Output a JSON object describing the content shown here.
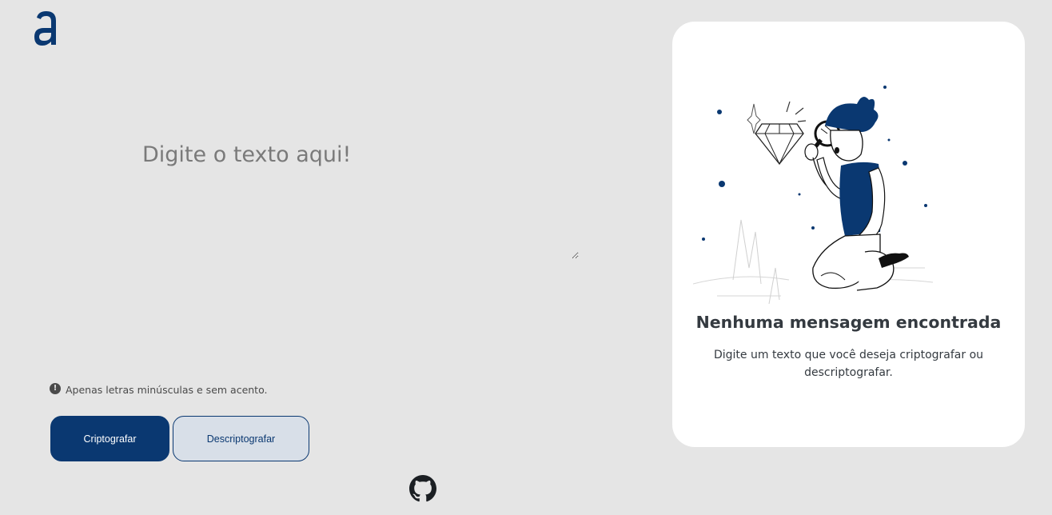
{
  "header": {
    "logo_icon": "alura-a-logo"
  },
  "editor": {
    "placeholder": "Digite o texto aqui!"
  },
  "hint": {
    "icon": "exclamation-circle-icon",
    "text": "Apenas letras minúsculas e sem acento."
  },
  "actions": {
    "encrypt_label": "Criptografar",
    "decrypt_label": "Descriptografar"
  },
  "footer": {
    "icon": "github-icon"
  },
  "result_card": {
    "illustration": "person-with-magnifying-glass",
    "title": "Nenhuma mensagem encontrada",
    "text": "Digite um texto que você deseja criptografar ou descriptografar."
  },
  "colors": {
    "background": "#e5e5e5",
    "primary": "#0a3871",
    "secondary_bg": "#d8dfe8",
    "card": "#ffffff",
    "text_dark": "#343a40"
  }
}
